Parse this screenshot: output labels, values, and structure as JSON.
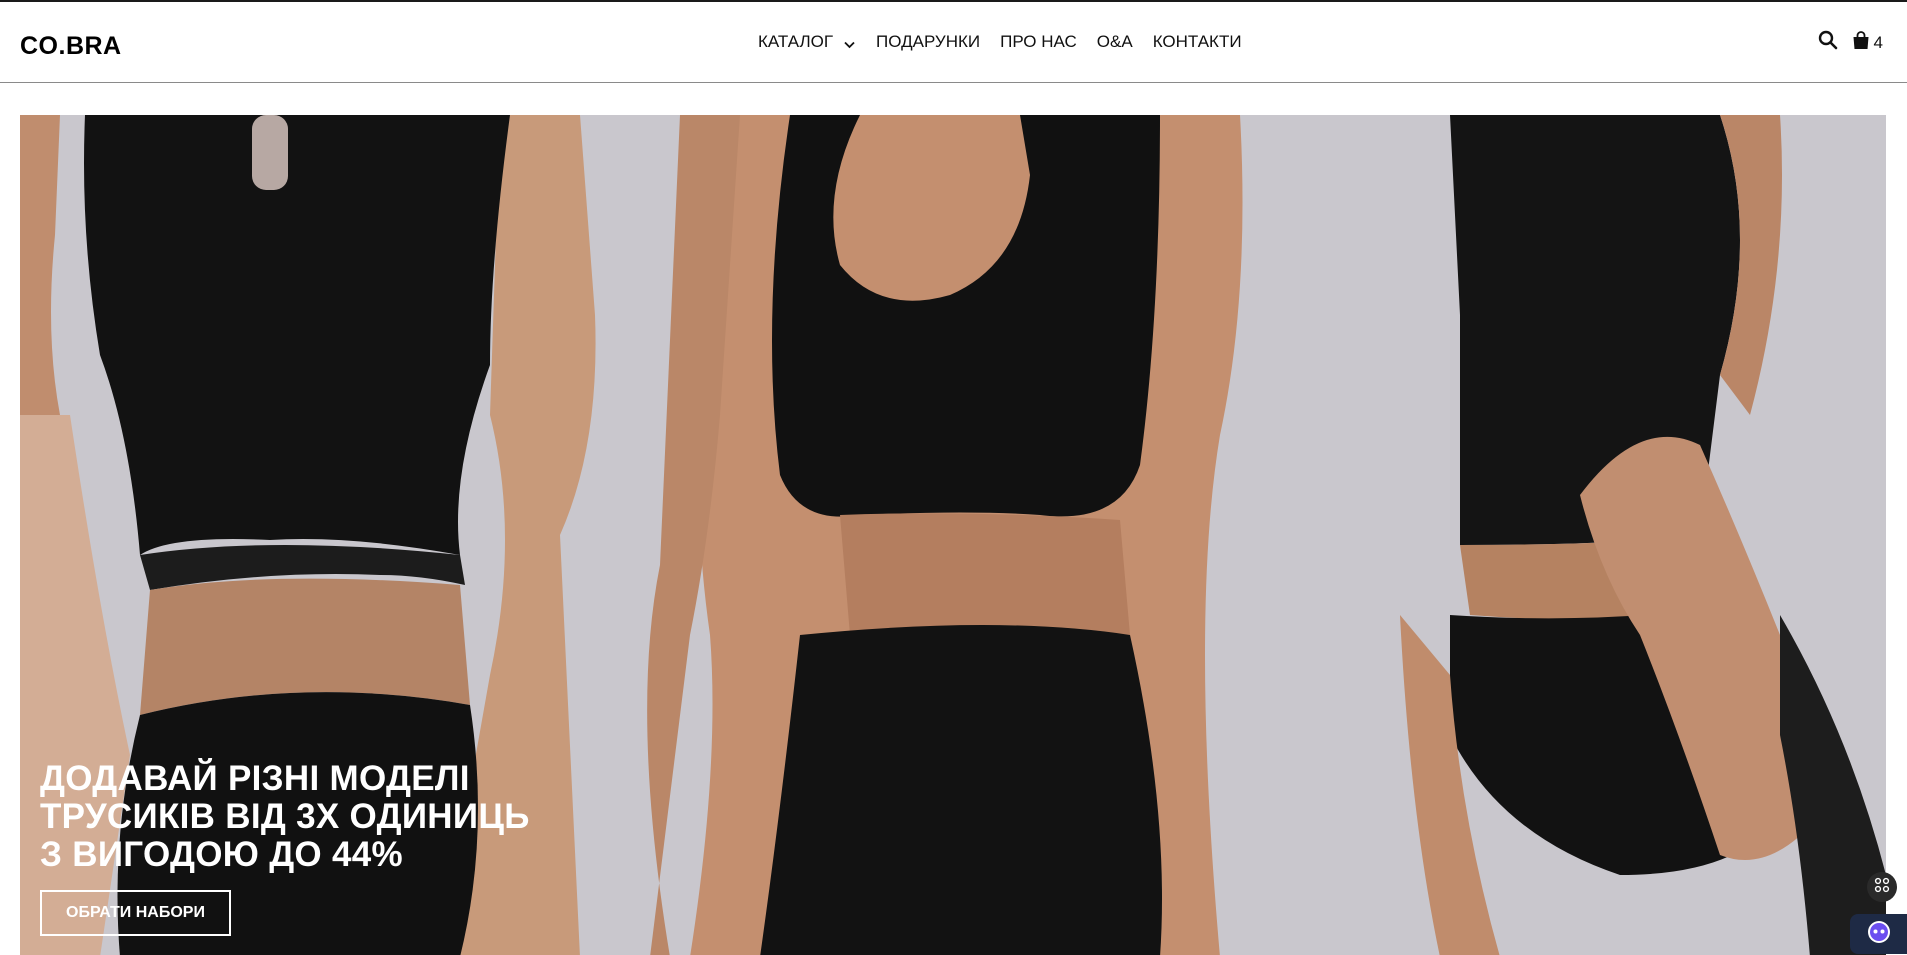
{
  "header": {
    "logo": "CO.BRA",
    "nav": [
      {
        "label": "КАТАЛОГ"
      },
      {
        "label": "ПОДАРУНКИ"
      },
      {
        "label": "ПРО НАС"
      },
      {
        "label": "О&А"
      },
      {
        "label": "КОНТАКТИ"
      }
    ],
    "cart_count": "4"
  },
  "hero": {
    "title": "ДОДАВАЙ РІЗНІ МОДЕЛІ ТРУСИКІВ ВІД 3Х ОДИНИЦЬ З ВИГОДОЮ ДО 44%",
    "button_label": "ОБРАТИ НАБОРИ"
  },
  "icons": {
    "search": "search-icon",
    "cart": "shopping-bag-icon",
    "catalog_dropdown": "chevron-down-icon",
    "widget": "grid-icon",
    "chat": "chat-bot-icon"
  },
  "colors": {
    "hero_background": "#c7c5cc",
    "garment": "#111111",
    "skin": "#c89a7a",
    "chat_widget": "#1e2a45"
  }
}
